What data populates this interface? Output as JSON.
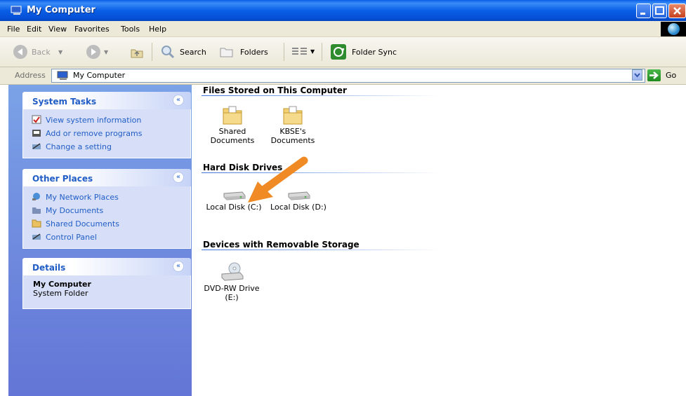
{
  "window": {
    "title": "My Computer"
  },
  "menu": [
    "File",
    "Edit",
    "View",
    "Favorites",
    "Tools",
    "Help"
  ],
  "toolbar": {
    "back": "Back",
    "search": "Search",
    "folders": "Folders",
    "folder_sync": "Folder Sync"
  },
  "address": {
    "label": "Address",
    "value": "My Computer",
    "go": "Go"
  },
  "sidebar": {
    "system_tasks": {
      "title": "System Tasks",
      "items": [
        "View system information",
        "Add or remove programs",
        "Change a setting"
      ]
    },
    "other_places": {
      "title": "Other Places",
      "items": [
        "My Network Places",
        "My Documents",
        "Shared Documents",
        "Control Panel"
      ]
    },
    "details": {
      "title": "Details",
      "name": "My Computer",
      "type": "System Folder"
    }
  },
  "content": {
    "files_group": {
      "title": "Files Stored on This Computer",
      "items": [
        {
          "line1": "Shared",
          "line2": "Documents"
        },
        {
          "line1": "KBSE's",
          "line2": "Documents"
        }
      ]
    },
    "disk_group": {
      "title": "Hard Disk Drives",
      "items": [
        "Local Disk (C:)",
        "Local Disk (D:)"
      ]
    },
    "removable_group": {
      "title": "Devices with Removable Storage",
      "items": [
        {
          "line1": "DVD-RW Drive",
          "line2": "(E:)"
        }
      ]
    }
  },
  "colors": {
    "title_bar": "#0a5fe6",
    "task_pane": "#7ba2e7",
    "link": "#215dc6",
    "annotation_arrow": "#f08a24"
  }
}
